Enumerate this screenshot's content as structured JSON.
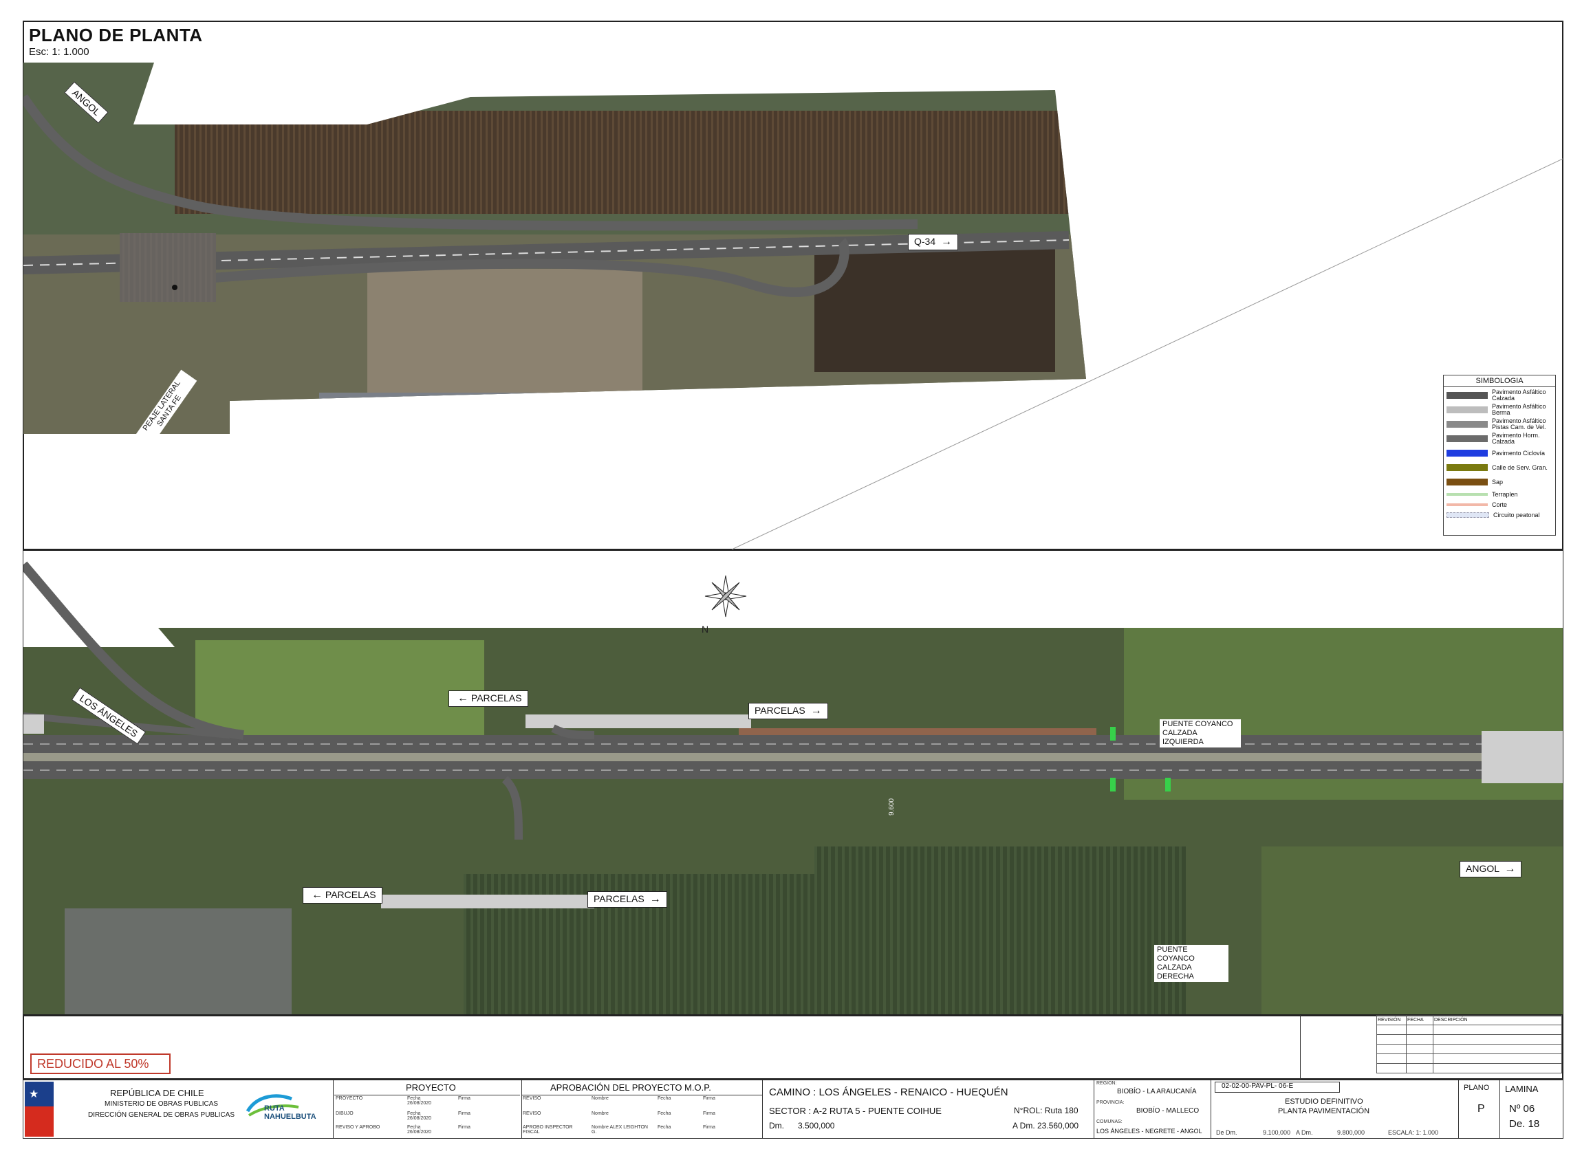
{
  "title": {
    "main": "PLANO DE PLANTA",
    "scale": "Esc: 1: 1.000"
  },
  "top_map": {
    "labels": {
      "angol": "ANGOL",
      "q34": "Q-34",
      "peaje": "PEAJE LATERAL SANTA FE"
    }
  },
  "bottom_map": {
    "labels": {
      "los_angeles": "LOS ÁNGELES",
      "parcelas": "PARCELAS",
      "puente_izq": "PUENTE COYANCO CALZADA IZQUIERDA",
      "puente_der": "PUENTE COYANCO CALZADA DERECHA",
      "angol": "ANGOL",
      "km": "9.600"
    }
  },
  "legend": {
    "title": "SIMBOLOGIA",
    "items": [
      {
        "label": "Pavimento Asfáltico Calzada",
        "color": "#555555"
      },
      {
        "label": "Pavimento Asfáltico Berma",
        "color": "#bdbdbd"
      },
      {
        "label": "Pavimento Asfáltico Pistas Cam. de Vel.",
        "color": "#8a8a8a"
      },
      {
        "label": "Pavimento Horm. Calzada",
        "color": "#6b6b6b"
      },
      {
        "label": "Pavimento Ciclovía",
        "color": "#1f3de0"
      },
      {
        "label": "Calle de Serv. Gran.",
        "color": "#7a7a10"
      },
      {
        "label": "Sap",
        "color": "#7a4f12"
      },
      {
        "label": "Terraplen",
        "color": "#b8e0b0"
      },
      {
        "label": "Corte",
        "color": "#f2b8a8"
      },
      {
        "label": "Circuito peatonal",
        "color": "#dfe6f5"
      }
    ]
  },
  "stamp": "REDUCIDO AL 50%",
  "title_block": {
    "republica": "REPÚBLICA DE CHILE",
    "ministerio": "MINISTERIO DE OBRAS PUBLICAS",
    "direccion": "DIRECCIÓN GENERAL DE OBRAS PUBLICAS",
    "logo_text": "RUTA NAHUELBUTA",
    "proyecto_hdr": "PROYECTO",
    "aprobacion_hdr": "APROBACIÓN DEL PROYECTO M.O.P.",
    "proyecto_rows": [
      {
        "role": "PROYECTO",
        "fecha": "Fecha 26/08/2020",
        "firma": "Firma"
      },
      {
        "role": "DIBUJO",
        "fecha": "Fecha 26/08/2020",
        "firma": "Firma"
      },
      {
        "role": "REVISO Y APROBO",
        "fecha": "Fecha 26/08/2020",
        "firma": "Firma"
      }
    ],
    "aprob_rows": [
      {
        "role": "REVISO",
        "nombre": "Nombre",
        "fecha": "Fecha",
        "firma": "Firma"
      },
      {
        "role": "REVISO",
        "nombre": "Nombre",
        "fecha": "Fecha",
        "firma": "Firma"
      },
      {
        "role": "APROBO INSPECTOR FISCAL",
        "nombre": "Nombre ALEX LEIGHTON G.",
        "fecha": "Fecha",
        "firma": "Firma"
      }
    ],
    "camino": "CAMINO : LOS ÁNGELES - RENAICO - HUEQUÉN",
    "sector": "SECTOR : A-2  RUTA 5 - PUENTE COIHUE",
    "rol": "N°ROL: Ruta 180",
    "dm_label": "Dm.",
    "dm": "3.500,000",
    "adm": "A Dm.  23.560,000",
    "region_lbl": "REGION:",
    "region": "BIOBÍO - LA ARAUCANÍA",
    "provincia_lbl": "PROVINCIA:",
    "provincia": "BIOBÍO - MALLECO",
    "comunas_lbl": "COMUNAS:",
    "comunas": "LOS ÁNGELES - NEGRETE - ANGOL",
    "codigo": "02-02-00-PAV-PL- 06-E",
    "estudio": "ESTUDIO DEFINITIVO",
    "planta": "PLANTA PAVIMENTACIÓN",
    "de_dm": "De Dm.",
    "de_dm_val": "9.100,000",
    "a_dm": "A Dm.",
    "a_dm_val": "9.800,000",
    "escala": "ESCALA:  1: 1.000",
    "plano_lbl": "PLANO",
    "plano_val": "P",
    "lamina_lbl": "LAMINA",
    "lamina_no": "Nº   06",
    "lamina_de": "De. 18",
    "rev_headers": [
      "REVISIÓN",
      "FECHA",
      "DESCRIPCIÓN"
    ]
  }
}
